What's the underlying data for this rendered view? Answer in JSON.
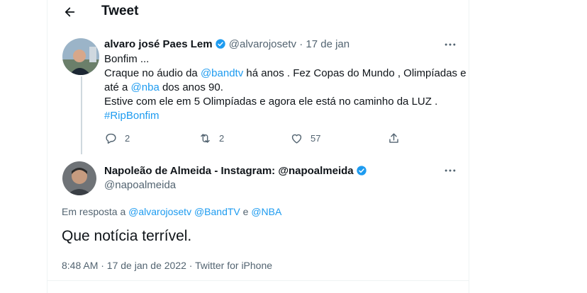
{
  "header": {
    "title": "Tweet",
    "back_icon": "arrow-left-icon"
  },
  "parent_tweet": {
    "name": "alvaro josé Paes Lem",
    "handle": "@alvarojosetv",
    "separator": "·",
    "date": "17 de jan",
    "verified": true,
    "lines": {
      "l1": "Bonfim ...",
      "l2_a": "Craque no áudio da ",
      "l2_link": "@bandtv",
      "l2_b": " há anos . Fez Copas do Mundo , Olimpíadas e",
      "l3_a": "até a ",
      "l3_link": "@nba",
      "l3_b": " dos anos 90.",
      "l4": "Estive com ele em 5 Olimpíadas e agora ele está no caminho da LUZ .",
      "l5_link": "#RipBonfim"
    },
    "actions": {
      "replies": "2",
      "retweets": "2",
      "likes": "57"
    }
  },
  "reply_tweet": {
    "name": "Napoleão de Almeida - Instagram: @napoalmeida",
    "handle": "@napoalmeida",
    "verified": true,
    "reply_prefix": "Em resposta a ",
    "reply_handles": "@alvarojosetv @BandTV",
    "reply_and": " e ",
    "reply_last": "@NBA",
    "text": "Que notícia terrível.",
    "meta": "8:48 AM · 17 de jan de 2022 · Twitter for iPhone"
  },
  "colors": {
    "accent": "#1d9bf0",
    "muted": "#536471",
    "text": "#0f1419",
    "border": "#eff3f4"
  }
}
